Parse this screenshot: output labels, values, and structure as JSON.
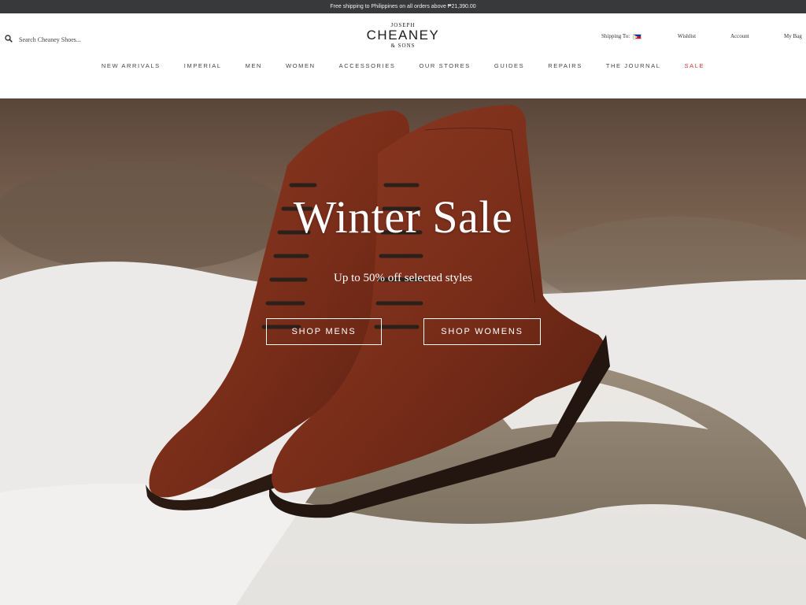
{
  "announcement": "Free shipping to Philippines on all orders above ₱21,390.00",
  "search": {
    "placeholder": "Search Cheaney Shoes..."
  },
  "logo": {
    "top": "JOSEPH",
    "main": "CHEANEY",
    "bottom": "& SONS"
  },
  "utility": {
    "shipping_label": "Shipping To:",
    "shipping_country_flag": "philippines-flag",
    "wishlist": "Wishlist",
    "account": "Account",
    "bag": "My Bag"
  },
  "nav": [
    "NEW ARRIVALS",
    "IMPERIAL",
    "MEN",
    "WOMEN",
    "ACCESSORIES",
    "OUR STORES",
    "GUIDES",
    "REPAIRS",
    "THE JOURNAL",
    "SALE"
  ],
  "hero": {
    "title": "Winter Sale",
    "subtitle": "Up to 50% off selected styles",
    "buttons": {
      "mens": "SHOP MENS",
      "womens": "SHOP WOMENS"
    }
  },
  "colors": {
    "announcement_bg": "#37393b",
    "sale": "#d0392e",
    "hero_text": "#ffffff"
  }
}
